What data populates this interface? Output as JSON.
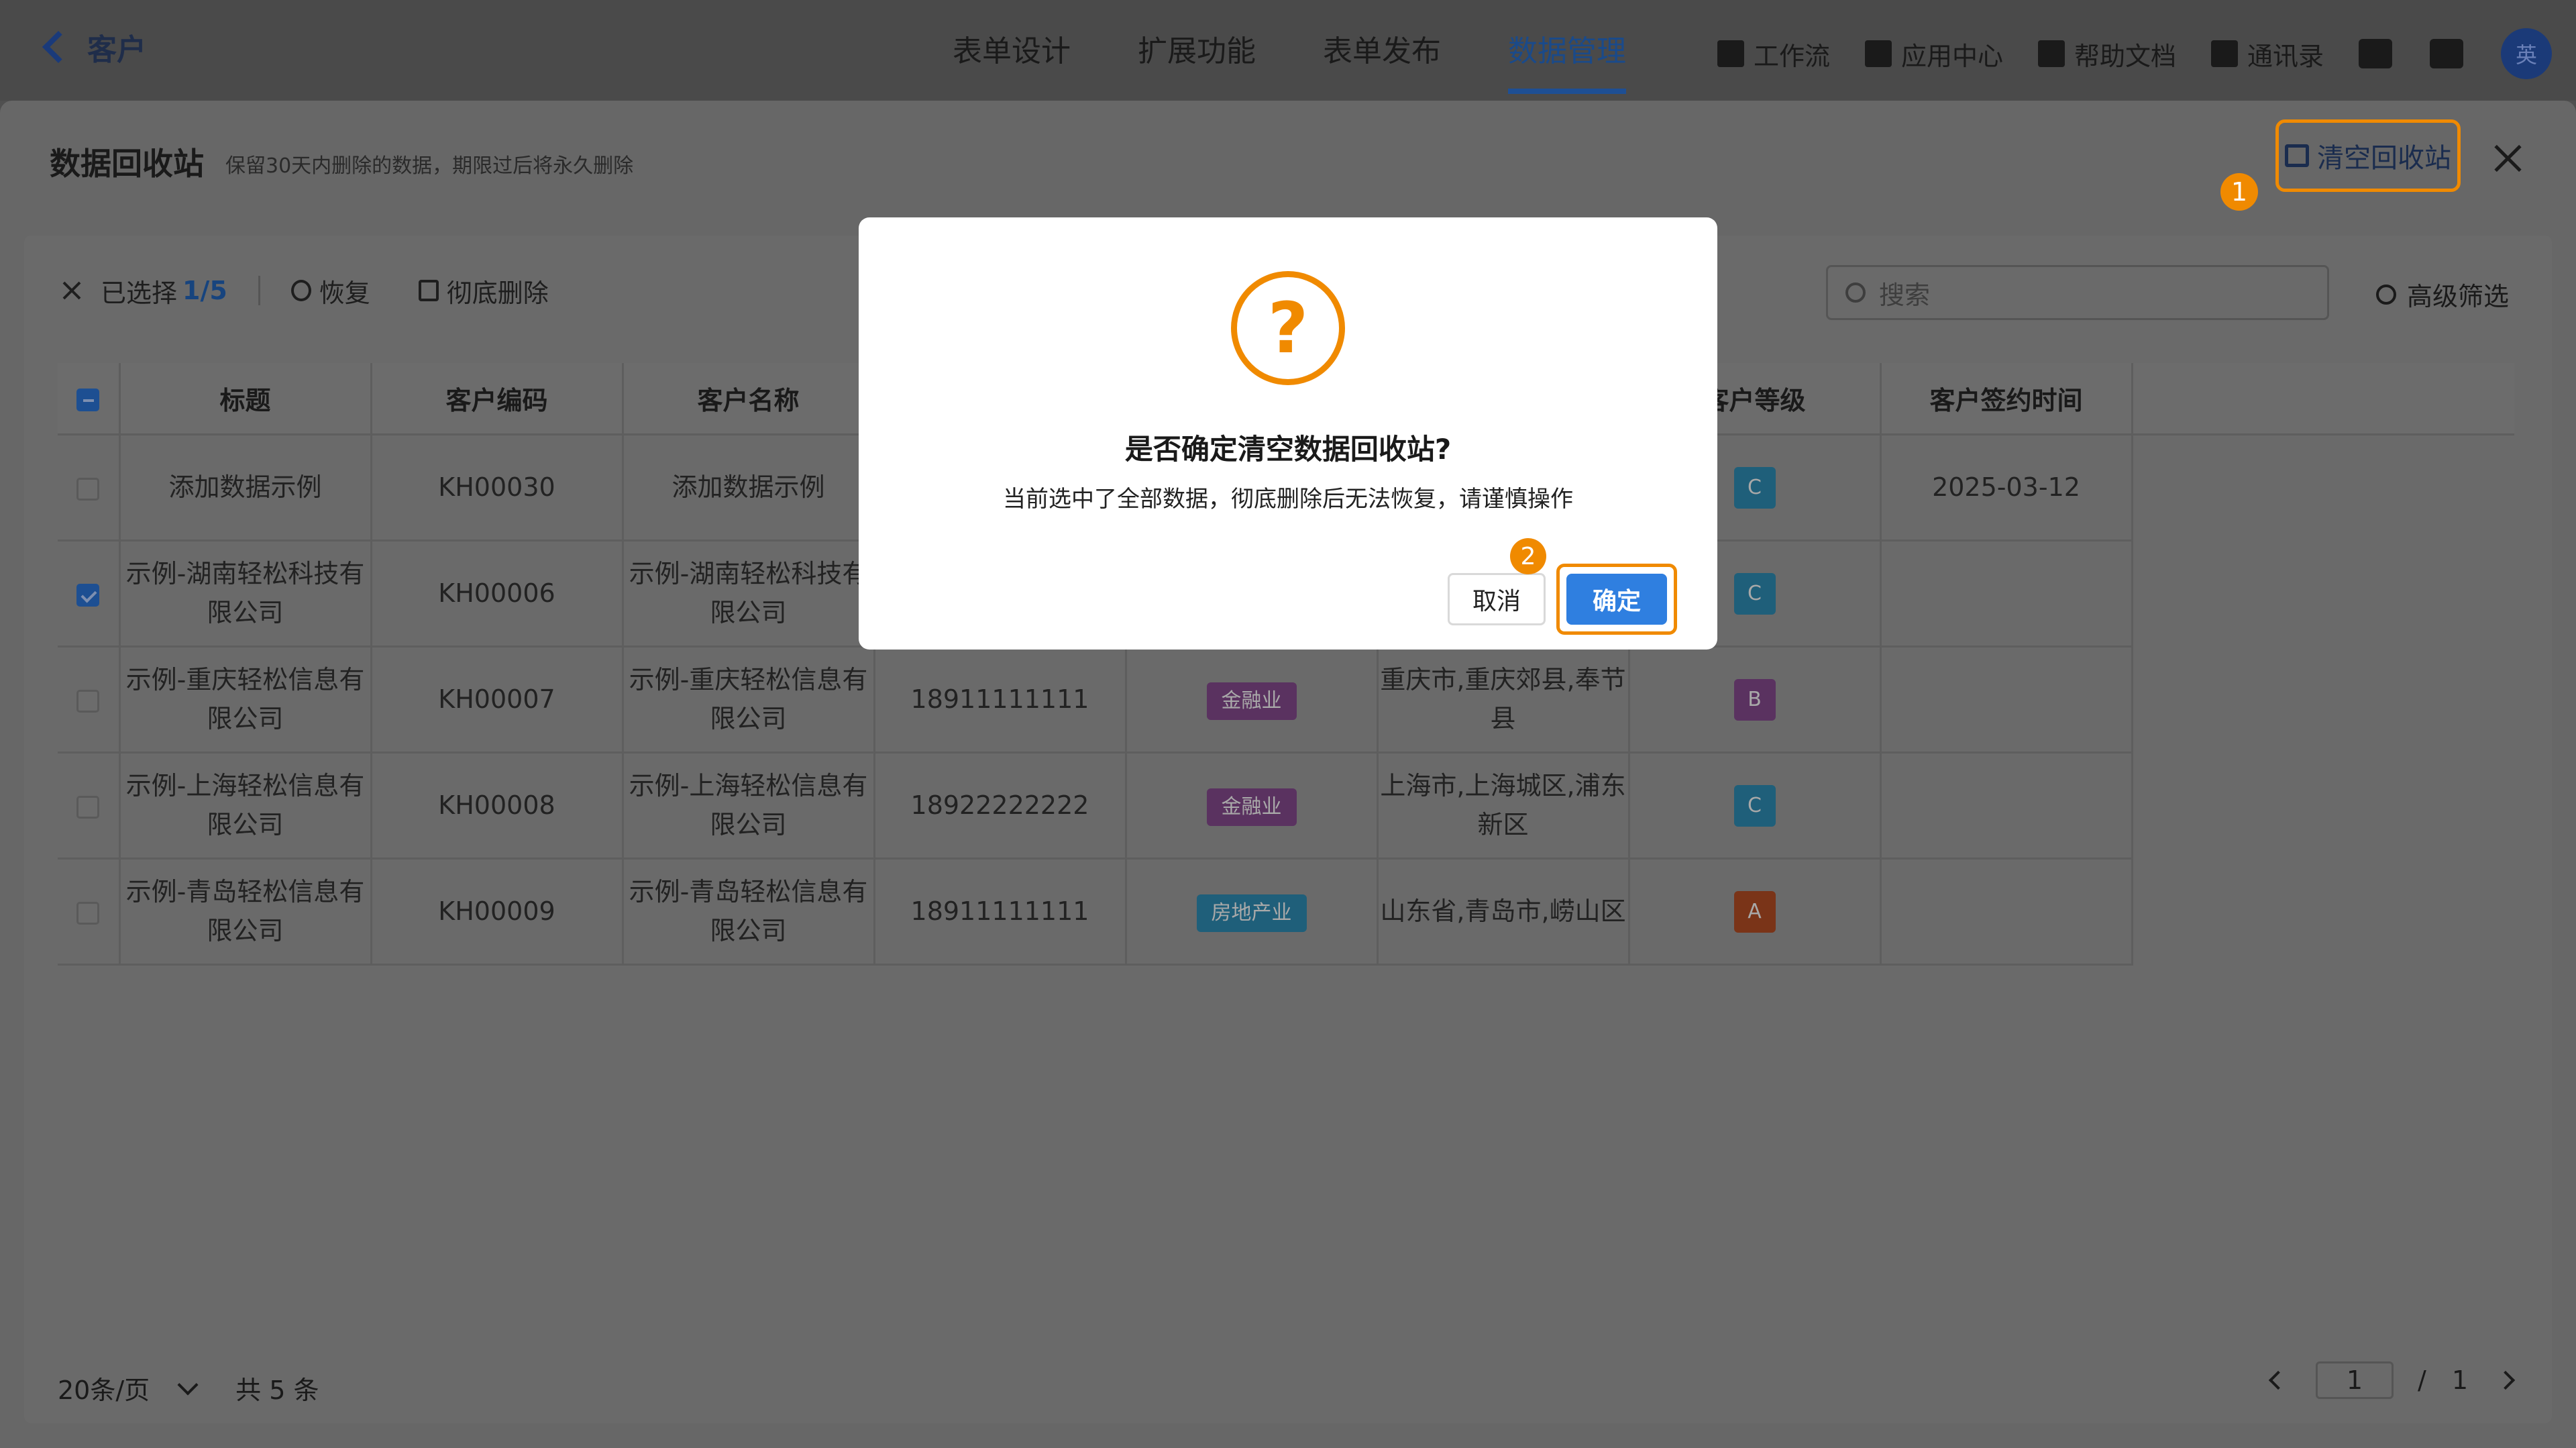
{
  "topbar": {
    "back_label": "客户",
    "tabs": [
      {
        "label": "表单设计"
      },
      {
        "label": "扩展功能"
      },
      {
        "label": "表单发布"
      },
      {
        "label": "数据管理"
      }
    ],
    "tools": [
      {
        "label": "工作流",
        "icon": "workflow-icon"
      },
      {
        "label": "应用中心",
        "icon": "app-center-icon"
      },
      {
        "label": "帮助文档",
        "icon": "help-doc-icon"
      },
      {
        "label": "通讯录",
        "icon": "contacts-icon"
      }
    ],
    "avatar_text": "英"
  },
  "recycle": {
    "title": "数据回收站",
    "subtitle": "保留30天内删除的数据，期限过后将永久删除",
    "empty_button": "清空回收站",
    "badge1": "1"
  },
  "toolbar": {
    "selected_label": "已选择",
    "selected_count": "1/5",
    "restore": "恢复",
    "delete_forever": "彻底删除",
    "search_placeholder": "搜索",
    "advanced_filter": "高级筛选"
  },
  "table": {
    "columns": [
      "标题",
      "客户编码",
      "客户名称",
      "",
      "",
      "",
      "客户等级",
      "客户签约时间"
    ],
    "rows": [
      {
        "checked": false,
        "title": "添加数据示例",
        "code": "KH00030",
        "name": "添加数据示例",
        "phone": "",
        "industry": "",
        "industry_color": "",
        "region": "",
        "level": "C",
        "level_color": "#1f5f7a",
        "signed": "2025-03-12"
      },
      {
        "checked": true,
        "title": "示例-湖南轻松科技有限公司",
        "code": "KH00006",
        "name": "示例-湖南轻松科技有限公司",
        "phone": "",
        "industry": "",
        "industry_color": "",
        "region": "",
        "level": "C",
        "level_color": "#1f5f7a",
        "signed": ""
      },
      {
        "checked": false,
        "title": "示例-重庆轻松信息有限公司",
        "code": "KH00007",
        "name": "示例-重庆轻松信息有限公司",
        "phone": "18911111111",
        "industry": "金融业",
        "industry_color": "#5a3260",
        "region": "重庆市,重庆郊县,奉节县",
        "level": "B",
        "level_color": "#5a3260",
        "signed": ""
      },
      {
        "checked": false,
        "title": "示例-上海轻松信息有限公司",
        "code": "KH00008",
        "name": "示例-上海轻松信息有限公司",
        "phone": "18922222222",
        "industry": "金融业",
        "industry_color": "#5a3260",
        "region": "上海市,上海城区,浦东新区",
        "level": "C",
        "level_color": "#1f5f7a",
        "signed": ""
      },
      {
        "checked": false,
        "title": "示例-青岛轻松信息有限公司",
        "code": "KH00009",
        "name": "示例-青岛轻松信息有限公司",
        "phone": "18911111111",
        "industry": "房地产业",
        "industry_color": "#1f5f7a",
        "region": "山东省,青岛市,崂山区",
        "level": "A",
        "level_color": "#7a3418",
        "signed": ""
      }
    ]
  },
  "pagination": {
    "page_size": "20条/页",
    "total": "共 5 条",
    "current": "1",
    "separator": "/",
    "pages": "1"
  },
  "modal": {
    "icon": "question-icon",
    "title": "是否确定清空数据回收站?",
    "desc": "当前选中了全部数据，彻底删除后无法恢复，请谨慎操作",
    "cancel": "取消",
    "confirm": "确定",
    "badge2": "2"
  },
  "colors": {
    "accent": "#f08a00",
    "primary": "#2f7fe0",
    "nav_active": "#1e4f94"
  }
}
